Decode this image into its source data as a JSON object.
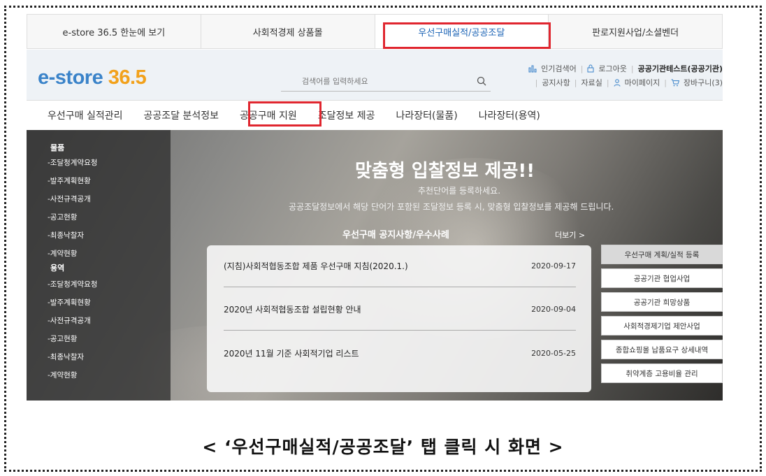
{
  "top_tabs": [
    {
      "label": "e-store 36.5  한눈에 보기"
    },
    {
      "label": "사회적경제 상품몰"
    },
    {
      "label": "우선구매실적/공공조달"
    },
    {
      "label": "판로지원사업/소셜벤더"
    }
  ],
  "logo": {
    "part1": "e-store ",
    "part2": "36.5"
  },
  "search": {
    "placeholder": "검색어를 입력하세요"
  },
  "util_top": {
    "popular": "인기검색어",
    "logout": "로그아웃",
    "user": "공공기관테스트(공공기관)"
  },
  "util_bottom": {
    "notice": "공지사항",
    "archive": "자료실",
    "mypage": "마이페이지",
    "cart": "장바구니(3)"
  },
  "nav": [
    {
      "label": "우선구매 실적관리"
    },
    {
      "label": "공공조달 분석정보"
    },
    {
      "label": "공공구매 지원"
    },
    {
      "label": "조달정보 제공"
    },
    {
      "label": "나라장터(물품)"
    },
    {
      "label": "나라장터(용역)"
    }
  ],
  "sidebar": {
    "goods_head": "물품",
    "goods": [
      "-조달청계약요청",
      "-발주계획현황",
      "-사전규격공개",
      "-공고현황",
      "-최종낙찰자",
      "-계약현황"
    ],
    "service_head": "용역",
    "services": [
      "-조달청계약요청",
      "-발주계획현황",
      "-사전규격공개",
      "-공고현황",
      "-최종낙찰자",
      "-계약현황"
    ]
  },
  "hero": {
    "title": "맞춤형 입찰정보 제공!!",
    "sub1": "추천단어를 등록하세요.",
    "sub2": "공공조달정보에서 해당 단어가 포함된 조달정보 등록 시, 맞춤형 입찰정보를 제공해 드립니다."
  },
  "notice": {
    "title": "우선구매 공지사항/우수사례",
    "more": "더보기 >",
    "items": [
      {
        "title": "(지침)사회적협동조합 제품 우선구매 지침(2020.1.)",
        "date": "2020-09-17"
      },
      {
        "title": "2020년 사회적협동조합 설립현황 안내",
        "date": "2020-09-04"
      },
      {
        "title": "2020년 11월 기준 사회적기업 리스트",
        "date": "2020-05-25"
      }
    ]
  },
  "quick_buttons": [
    "우선구매 계획/실적 등록",
    "공공기관 협업사업",
    "공공기관 희망상품",
    "사회적경제기업 제안사업",
    "종합쇼핑몰 납품요구 상세내역",
    "취약계층 고용비율 관리"
  ],
  "caption": "< ‘우선구매실적/공공조달’ 탭 클릭 시 화면 >",
  "colors": {
    "accent_blue": "#3a83c9",
    "accent_orange": "#f2a11b",
    "highlight_red": "#e0262f"
  }
}
